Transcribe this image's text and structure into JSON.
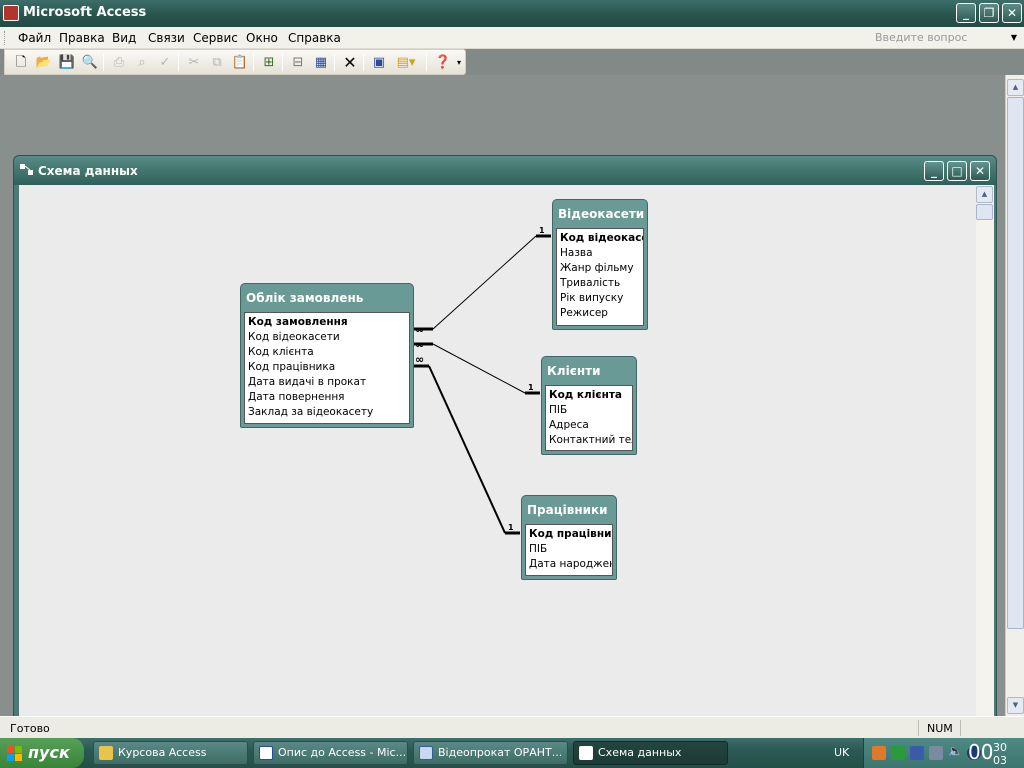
{
  "app": {
    "title": "Microsoft Access"
  },
  "menu": {
    "items": [
      "Файл",
      "Правка",
      "Вид",
      "Связи",
      "Сервис",
      "Окно",
      "Справка"
    ],
    "ask_placeholder": "Введите вопрос"
  },
  "window": {
    "title": "Схема данных"
  },
  "relationship_tables": [
    {
      "name": "Облік замовлень",
      "fields": [
        "Код замовлення",
        "Код відеокасети",
        "Код клієнта",
        "Код працівника",
        "Дата видачі в прокат",
        "Дата повернення",
        "Заклад за відеокасету"
      ],
      "primary_key": "Код замовлення"
    },
    {
      "name": "Відеокасети",
      "fields": [
        "Код відеокасети",
        "Назва",
        "Жанр фільму",
        "Тривалість",
        "Рік випуску",
        "Режисер"
      ],
      "primary_key": "Код відеокасети"
    },
    {
      "name": "Клієнти",
      "fields": [
        "Код клієнта",
        "ПІБ",
        "Адреса",
        "Контактний тел"
      ],
      "primary_key": "Код клієнта"
    },
    {
      "name": "Працівники",
      "fields": [
        "Код працівника",
        "ПІБ",
        "Дата народжень"
      ],
      "primary_key": "Код працівника"
    }
  ],
  "relationships": [
    {
      "from": "Облік замовлень",
      "to": "Відеокасети",
      "many_label": "∞",
      "one_label": "1"
    },
    {
      "from": "Облік замовлень",
      "to": "Клієнти",
      "many_label": "∞",
      "one_label": "1"
    },
    {
      "from": "Облік замовлень",
      "to": "Працівники",
      "many_label": "∞",
      "one_label": "1"
    }
  ],
  "status": {
    "text": "Готово",
    "num": "NUM"
  },
  "taskbar": {
    "start_label": "пуск",
    "tasks": [
      "Курсова Access",
      "Опис до Access - Mic...",
      "Відеопрокат ОРАНТ...",
      "Схема данных"
    ],
    "language": "UK",
    "clock_hour": "00",
    "clock_min": "30",
    "clock_sec": "03"
  },
  "colors": {
    "title_bar": "#2a5650",
    "canvas": "#ebebeb",
    "table_header": "#6a9a95",
    "workspace": "#888f8d"
  }
}
